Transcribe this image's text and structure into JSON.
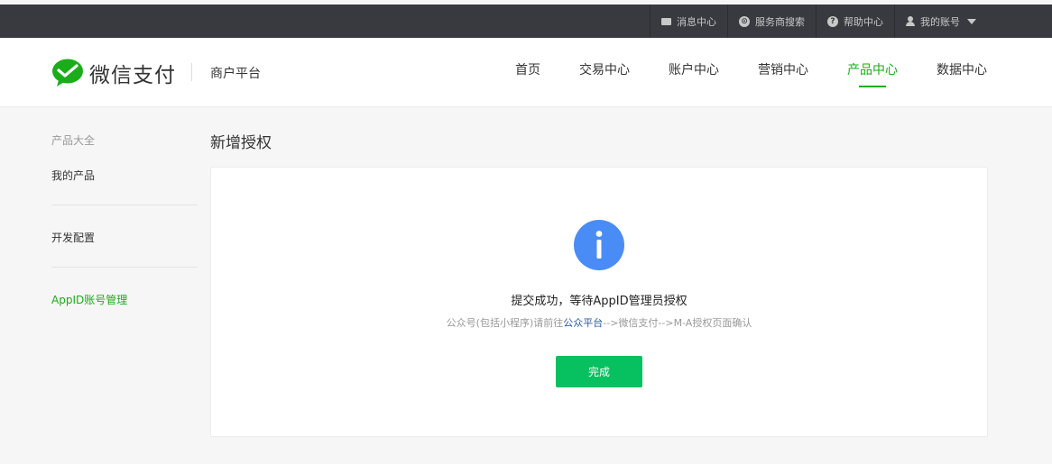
{
  "topbar": {
    "items": [
      {
        "label": "消息中心",
        "icon": "mail-icon"
      },
      {
        "label": "服务商搜索",
        "icon": "search-circle-icon"
      },
      {
        "label": "帮助中心",
        "icon": "help-icon"
      },
      {
        "label": "我的账号",
        "icon": "user-icon"
      }
    ]
  },
  "header": {
    "logo_text": "微信支付",
    "platform": "商户平台",
    "nav": [
      {
        "label": "首页"
      },
      {
        "label": "交易中心"
      },
      {
        "label": "账户中心"
      },
      {
        "label": "营销中心"
      },
      {
        "label": "产品中心",
        "active": true
      },
      {
        "label": "数据中心"
      }
    ]
  },
  "sidebar": {
    "heading": "产品大全",
    "items": [
      {
        "label": "我的产品"
      },
      {
        "label": "开发配置"
      },
      {
        "label": "AppID账号管理",
        "active": true
      }
    ]
  },
  "main": {
    "title": "新增授权",
    "message_title": "提交成功，等待AppID管理员授权",
    "message_sub_before": "公众号(包括小程序)请前往",
    "message_sub_link": "公众平台",
    "message_sub_after": "-->微信支付-->M-A授权页面确认",
    "done_label": "完成"
  },
  "colors": {
    "brand_green": "#1aad19",
    "button_green": "#07c160",
    "info_blue": "#4a8cf5",
    "topbar_bg": "#383a3f"
  }
}
